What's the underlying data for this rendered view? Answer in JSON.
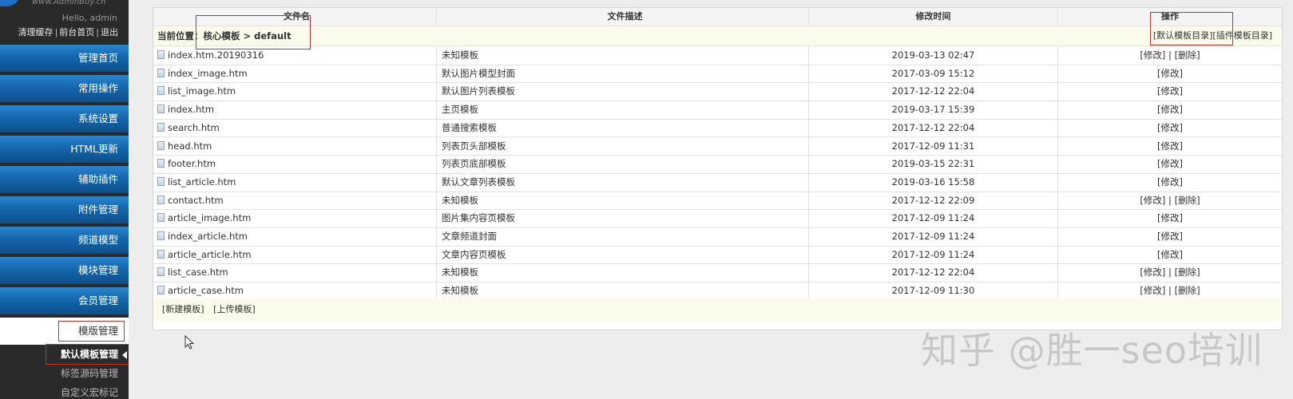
{
  "sidebar": {
    "logo_url": "www.AdminBuy.cn",
    "hello": "Hello, admin",
    "top_links": [
      "清理缓存",
      "前台首页",
      "退出"
    ],
    "menu": [
      "管理首页",
      "常用操作",
      "系统设置",
      "HTML更新",
      "辅助插件",
      "附件管理",
      "频道模型",
      "模块管理",
      "会员管理",
      "模版管理"
    ],
    "sub_menu": [
      "默认模板管理",
      "标签源码管理",
      "自定义宏标记"
    ]
  },
  "table": {
    "headers": [
      "文件名",
      "文件描述",
      "修改时间",
      "操作"
    ],
    "path_label": "当前位置：",
    "path_value": "核心模板 > default",
    "top_actions": [
      "[默认模板目录]",
      "[插件模板目录]"
    ],
    "rows": [
      {
        "file": "index.htm.20190316",
        "desc": "未知模板",
        "time": "2019-03-13 02:47",
        "ops": "[修改] | [删除]"
      },
      {
        "file": "index_image.htm",
        "desc": "默认图片模型封面",
        "time": "2017-03-09 15:12",
        "ops": "[修改]"
      },
      {
        "file": "list_image.htm",
        "desc": "默认图片列表模板",
        "time": "2017-12-12 22:04",
        "ops": "[修改]"
      },
      {
        "file": "index.htm",
        "desc": "主页模板",
        "time": "2019-03-17 15:39",
        "ops": "[修改]"
      },
      {
        "file": "search.htm",
        "desc": "普通搜索模板",
        "time": "2017-12-12 22:04",
        "ops": "[修改]"
      },
      {
        "file": "head.htm",
        "desc": "列表页头部模板",
        "time": "2017-12-09 11:31",
        "ops": "[修改]"
      },
      {
        "file": "footer.htm",
        "desc": "列表页底部模板",
        "time": "2019-03-15 22:31",
        "ops": "[修改]"
      },
      {
        "file": "list_article.htm",
        "desc": "默认文章列表模板",
        "time": "2019-03-16 15:58",
        "ops": "[修改]"
      },
      {
        "file": "contact.htm",
        "desc": "未知模板",
        "time": "2017-12-12 22:09",
        "ops": "[修改] | [删除]"
      },
      {
        "file": "article_image.htm",
        "desc": "图片集内容页模板",
        "time": "2017-12-09 11:24",
        "ops": "[修改]"
      },
      {
        "file": "index_article.htm",
        "desc": "文章频道封面",
        "time": "2017-12-09 11:24",
        "ops": "[修改]"
      },
      {
        "file": "article_article.htm",
        "desc": "文章内容页模板",
        "time": "2017-12-09 11:24",
        "ops": "[修改]"
      },
      {
        "file": "list_case.htm",
        "desc": "未知模板",
        "time": "2017-12-12 22:04",
        "ops": "[修改] | [删除]"
      },
      {
        "file": "article_case.htm",
        "desc": "未知模板",
        "time": "2017-12-09 11:30",
        "ops": "[修改] | [删除]"
      }
    ],
    "footer_actions": [
      "[新建模板]",
      "[上传模板]"
    ]
  },
  "watermark": "知乎 @胜一seo培训",
  "colors": {
    "menu_blue": "#1566ad",
    "highlight_red": "#c8302e",
    "pale_yellow": "#fbfbec"
  }
}
